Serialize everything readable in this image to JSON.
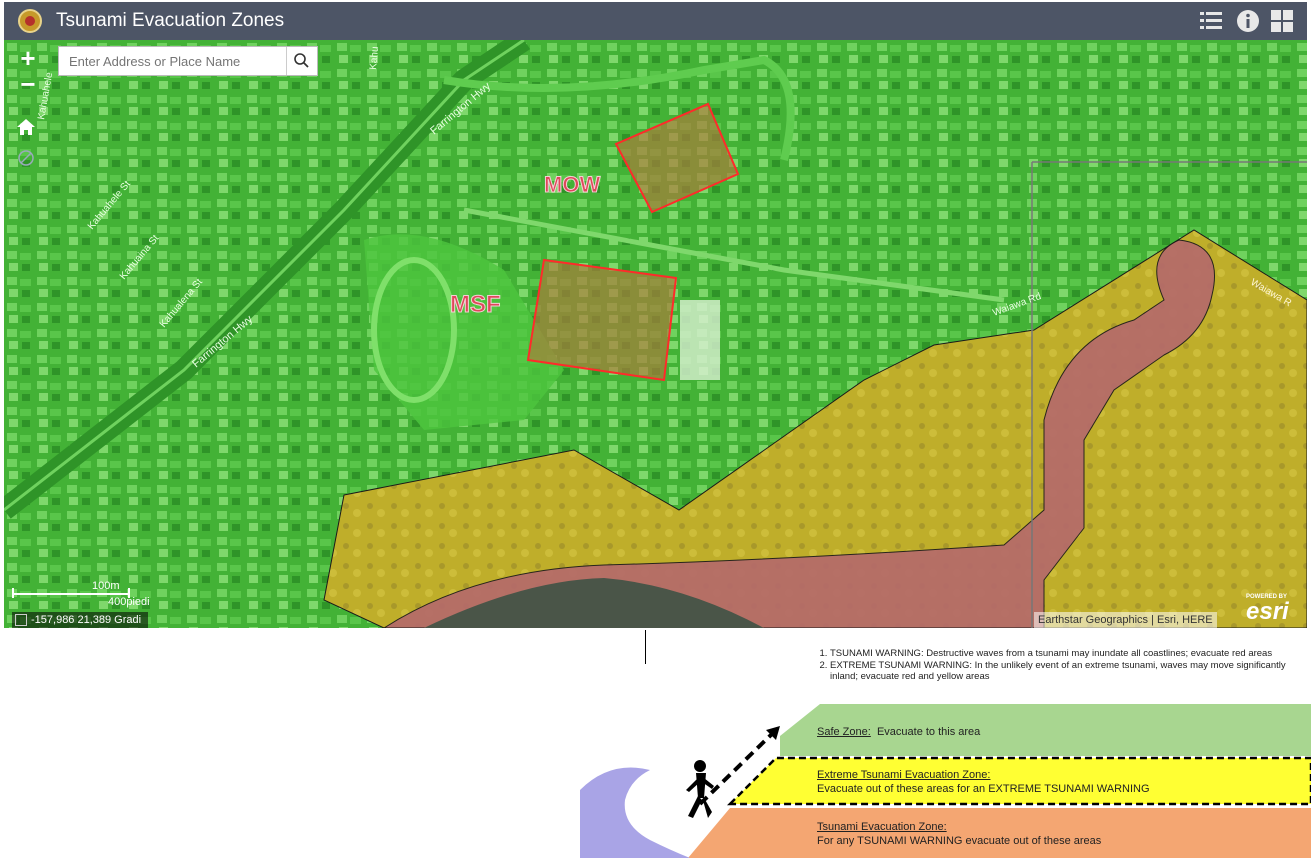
{
  "header": {
    "title": "Tsunami Evacuation Zones",
    "icons": [
      "list-icon",
      "info-icon",
      "grid-icon"
    ]
  },
  "map": {
    "search_placeholder": "Enter Address or Place Name",
    "labels": {
      "mow": "MOW",
      "msf": "MSF"
    },
    "streets": [
      "Farrington Hwy",
      "Farrington Hwy",
      "Kahuahele St",
      "Kahuaina St",
      "Kahualena St",
      "Waiawa Rd",
      "Waiawa R",
      "Kahu",
      "Kahuahele"
    ],
    "scale": {
      "metric": "100m",
      "imperial": "400piedi"
    },
    "coordinates": "-157,986 21,389 Gradi",
    "attribution": "Earthstar Geographics | Esri, HERE",
    "esri": {
      "powered": "POWERED BY",
      "name": "esri"
    },
    "colors": {
      "safe_zone": "#3fbf2e",
      "extreme_zone": "#c7b22a",
      "tsunami_zone": "#b56a6a",
      "label_color": "#e0475a"
    }
  },
  "legend": {
    "notes": [
      "TSUNAMI WARNING:  Destructive waves from a tsunami may inundate all coastlines; evacuate red areas",
      "EXTREME TSUNAMI WARNING:  In the unlikely event of an extreme tsunami, waves may move significantly inland; evacuate red and yellow areas"
    ],
    "zones": {
      "safe_title": "Safe Zone:",
      "safe_desc": "Evacuate to this area",
      "extreme_title": "Extreme Tsunami Evacuation Zone:",
      "extreme_desc": "Evacuate out of these areas for an EXTREME TSUNAMI WARNING",
      "tsunami_title": "Tsunami Evacuation Zone:",
      "tsunami_desc": "For any TSUNAMI WARNING evacuate out of these areas"
    },
    "colors": {
      "safe": "#a8d690",
      "extreme": "#ffff33",
      "tsunami": "#f4a672",
      "wave": "#a9a4e6"
    }
  }
}
